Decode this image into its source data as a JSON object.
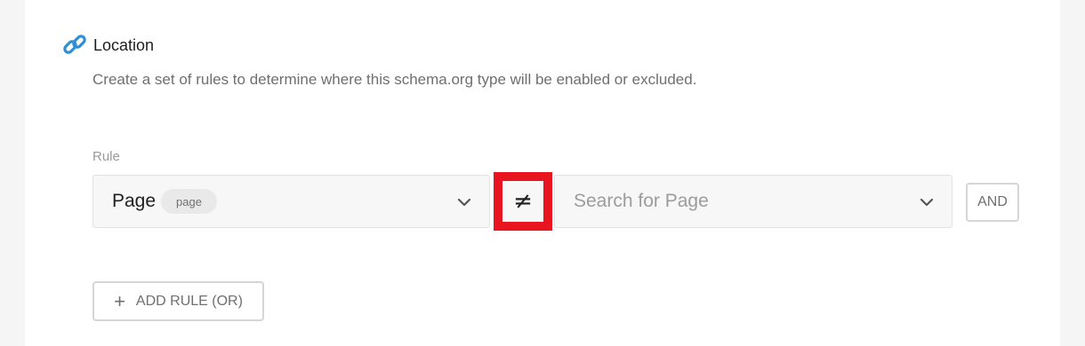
{
  "section": {
    "icon": "link-icon",
    "title": "Location",
    "description": "Create a set of rules to determine where this schema.org type will be enabled or excluded."
  },
  "rule": {
    "label": "Rule",
    "type_select": {
      "value": "Page",
      "tag": "page",
      "icon": "chevron-down-icon"
    },
    "operator": {
      "symbol": "≠"
    },
    "value_select": {
      "placeholder": "Search for Page",
      "icon": "chevron-down-icon"
    },
    "and_label": "AND"
  },
  "add_rule": {
    "icon": "plus-icon",
    "label": "ADD RULE (OR)"
  },
  "colors": {
    "highlight": "#e8141f",
    "link_icon": "#2e8fd6"
  }
}
